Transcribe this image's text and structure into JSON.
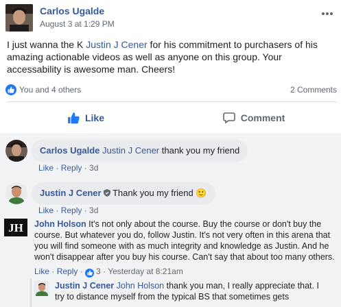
{
  "post": {
    "author": "Carlos Ugalde",
    "timestamp": "August 3 at 1:29 PM",
    "text_before": "I just wanna the K ",
    "mention": "Justin J Cener",
    "text_after": " for his commitment to purchasers of his amazing actionable videos as well as anyone on this group. Your accessability is awesome man. Cheers!",
    "reactions_text": "You and 4 others",
    "comments_count": "2 Comments",
    "like_label": "Like",
    "comment_label": "Comment"
  },
  "comments": [
    {
      "author": "Carlos Ugalde",
      "mention": "Justin J Cener",
      "text": " thank you my friend",
      "like": "Like",
      "reply": "Reply",
      "time": "3d"
    },
    {
      "author": "Justin J Cener",
      "text": " Thank you my friend ",
      "emoji": "🙂",
      "like": "Like",
      "reply": "Reply",
      "time": "3d"
    },
    {
      "author": "John Holson",
      "text": " It's not only about the course. Buy the course or don't buy the course. But whatever you do, follow Justin. It's not very often in this arena that you will find someone with as much integrity and knowledge as Justin. And he won't disappear after you buy his course. Can't say that about too many others.",
      "like": "Like",
      "reply": "Reply",
      "likes_count": "3",
      "time": "Yesterday at 8:21am"
    },
    {
      "author": "Justin J Cener",
      "mention": "John Holson",
      "text": " thank you man, I really appreciate that. I try to distance myself from the typical BS that sometimes gets"
    }
  ],
  "icons": {
    "more": "more-icon",
    "like": "thumbs-up-icon",
    "comment": "speech-bubble-icon",
    "verified": "shield-badge-icon"
  },
  "colors": {
    "link": "#365899",
    "like_blue": "#2078f4",
    "muted": "#606770",
    "comment_bg": "#f2f3f5",
    "bubble_bg": "#e9ebee"
  }
}
